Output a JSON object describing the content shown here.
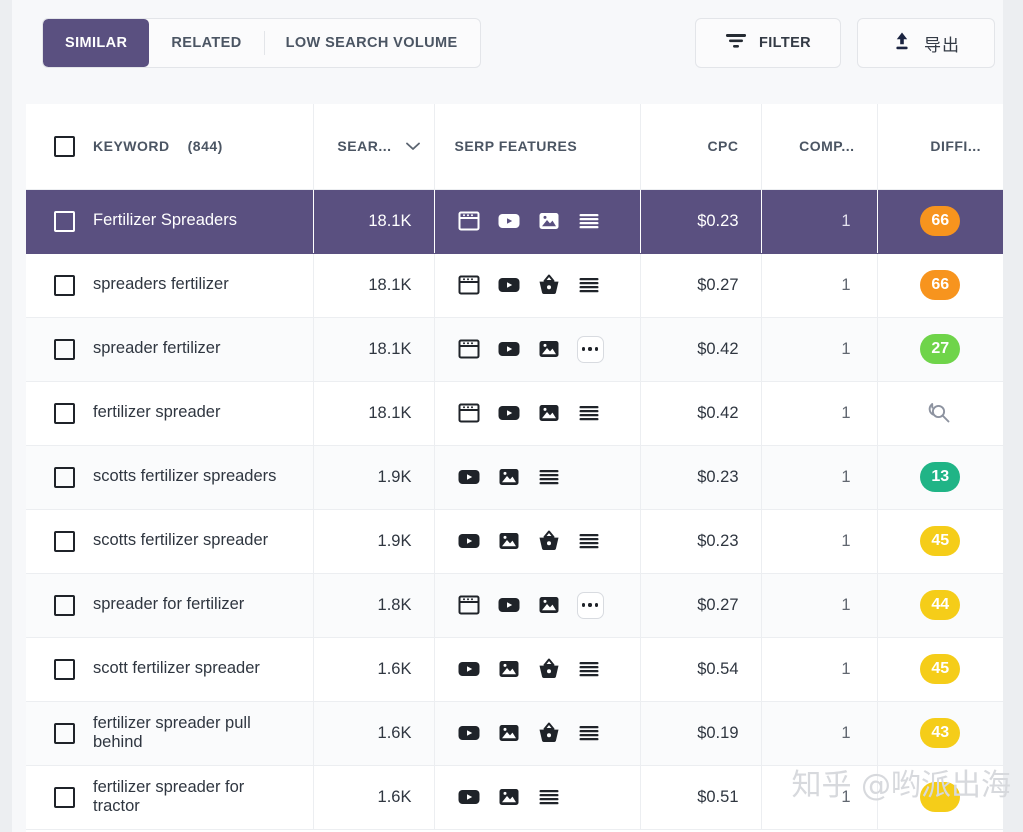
{
  "toolbar": {
    "tabs": [
      {
        "label": "SIMILAR",
        "active": true
      },
      {
        "label": "RELATED",
        "active": false
      },
      {
        "label": "LOW SEARCH VOLUME",
        "active": false
      }
    ],
    "filter_label": "FILTER",
    "filter_icon": "filter-icon",
    "export_label": "导出",
    "export_icon": "upload-icon"
  },
  "table": {
    "columns": [
      {
        "key": "keyword",
        "label": "KEYWORD",
        "count": "(844)",
        "has_checkbox": true
      },
      {
        "key": "volume",
        "label": "SEAR...",
        "sort_icon": "chevron-down-icon"
      },
      {
        "key": "serp",
        "label": "SERP FEATURES"
      },
      {
        "key": "cpc",
        "label": "CPC"
      },
      {
        "key": "competition",
        "label": "COMP..."
      },
      {
        "key": "difficulty",
        "label": "DIFFI..."
      }
    ],
    "rows": [
      {
        "keyword": "Fertilizer Spreaders",
        "volume": "18.1K",
        "serp": [
          "top-ads-icon",
          "video-icon",
          "image-icon",
          "reviews-icon"
        ],
        "cpc": "$0.23",
        "competition": "1",
        "difficulty": "66",
        "difficulty_color": "#f7941e",
        "selected": true
      },
      {
        "keyword": "spreaders fertilizer",
        "volume": "18.1K",
        "serp": [
          "top-ads-icon",
          "video-icon",
          "shopping-icon",
          "reviews-icon"
        ],
        "cpc": "$0.27",
        "competition": "1",
        "difficulty": "66",
        "difficulty_color": "#f7941e",
        "selected": false
      },
      {
        "keyword": "spreader fertilizer",
        "volume": "18.1K",
        "serp": [
          "top-ads-icon",
          "video-icon",
          "image-icon",
          "more-icon"
        ],
        "cpc": "$0.42",
        "competition": "1",
        "difficulty": "27",
        "difficulty_color": "#6fd44a",
        "selected": false
      },
      {
        "keyword": "fertilizer spreader",
        "volume": "18.1K",
        "serp": [
          "top-ads-icon",
          "video-icon",
          "image-icon",
          "reviews-icon"
        ],
        "cpc": "$0.42",
        "competition": "1",
        "difficulty": "",
        "difficulty_icon": "recalculate-difficulty-icon",
        "selected": false
      },
      {
        "keyword": "scotts fertilizer spreaders",
        "volume": "1.9K",
        "serp": [
          "video-icon",
          "image-icon",
          "reviews-icon"
        ],
        "cpc": "$0.23",
        "competition": "1",
        "difficulty": "13",
        "difficulty_color": "#20b486",
        "selected": false
      },
      {
        "keyword": "scotts fertilizer spreader",
        "volume": "1.9K",
        "serp": [
          "video-icon",
          "image-icon",
          "shopping-icon",
          "reviews-icon"
        ],
        "cpc": "$0.23",
        "competition": "1",
        "difficulty": "45",
        "difficulty_color": "#f5cd19",
        "selected": false
      },
      {
        "keyword": "spreader for fertilizer",
        "volume": "1.8K",
        "serp": [
          "top-ads-icon",
          "video-icon",
          "image-icon",
          "more-icon"
        ],
        "cpc": "$0.27",
        "competition": "1",
        "difficulty": "44",
        "difficulty_color": "#f5cd19",
        "selected": false
      },
      {
        "keyword": "scott fertilizer spreader",
        "volume": "1.6K",
        "serp": [
          "video-icon",
          "image-icon",
          "shopping-icon",
          "reviews-icon"
        ],
        "cpc": "$0.54",
        "competition": "1",
        "difficulty": "45",
        "difficulty_color": "#f5cd19",
        "selected": false
      },
      {
        "keyword": "fertilizer spreader pull behind",
        "volume": "1.6K",
        "serp": [
          "video-icon",
          "image-icon",
          "shopping-icon",
          "reviews-icon"
        ],
        "cpc": "$0.19",
        "competition": "1",
        "difficulty": "43",
        "difficulty_color": "#f5cd19",
        "selected": false
      },
      {
        "keyword": "fertilizer spreader for tractor",
        "volume": "1.6K",
        "serp": [
          "video-icon",
          "image-icon",
          "reviews-icon"
        ],
        "cpc": "$0.51",
        "competition": "1",
        "difficulty": "",
        "difficulty_color": "#f5cd19",
        "selected": false
      }
    ]
  },
  "watermark": {
    "text": "知乎 @哟派出海"
  },
  "colors": {
    "selected_row": "#5a5080",
    "accent_purple": "#5a5080",
    "orange": "#f7941e",
    "green": "#6fd44a",
    "teal": "#20b486",
    "yellow": "#f5cd19"
  }
}
